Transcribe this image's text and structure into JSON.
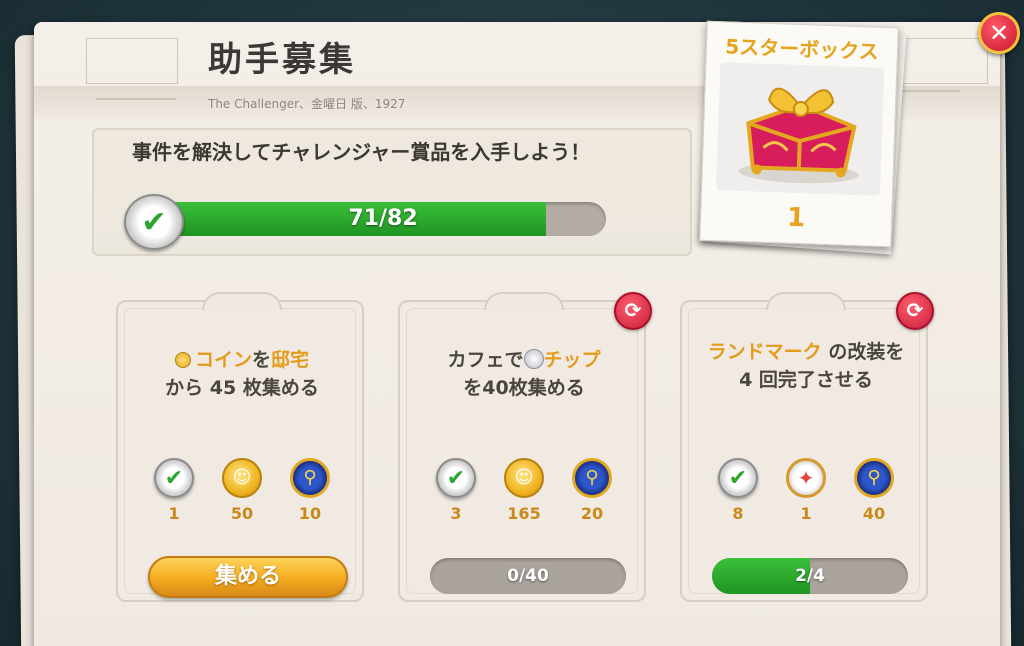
{
  "header": {
    "title": "助手募集",
    "subtitle": "The Challenger、金曜日 版、1927"
  },
  "mission": {
    "text": "事件を解決してチャレンジャー賞品を入手しよう！",
    "progress_label": "71/82",
    "progress_current": 71,
    "progress_total": 82
  },
  "prize": {
    "title": "5スターボックス",
    "count": "1"
  },
  "colors": {
    "accent_gold": "#e7a31c",
    "progress_green": "#1f9423",
    "close_red": "#c8142e"
  },
  "tasks": [
    {
      "text_parts": [
        "コイン",
        "を",
        "邸宅",
        "から 45 枚集める"
      ],
      "rewards": [
        {
          "icon": "check-medal-icon",
          "value": "1"
        },
        {
          "icon": "gold-coin-icon",
          "value": "50"
        },
        {
          "icon": "magnifier-badge-icon",
          "value": "10"
        }
      ],
      "action_label": "集める"
    },
    {
      "text_parts": [
        "カフェで",
        "チップ",
        "を40枚集める"
      ],
      "rewards": [
        {
          "icon": "check-medal-icon",
          "value": "3"
        },
        {
          "icon": "gold-coin-icon",
          "value": "165"
        },
        {
          "icon": "magnifier-badge-icon",
          "value": "20"
        }
      ],
      "progress_label": "0/40",
      "progress_fraction": 0.0
    },
    {
      "text_parts": [
        "ランドマーク",
        "の改装を 4 回完了させる"
      ],
      "rewards": [
        {
          "icon": "check-medal-icon",
          "value": "8"
        },
        {
          "icon": "compass-icon",
          "value": "1"
        },
        {
          "icon": "magnifier-badge-icon",
          "value": "40"
        }
      ],
      "progress_label": "2/4",
      "progress_fraction": 0.5
    }
  ]
}
